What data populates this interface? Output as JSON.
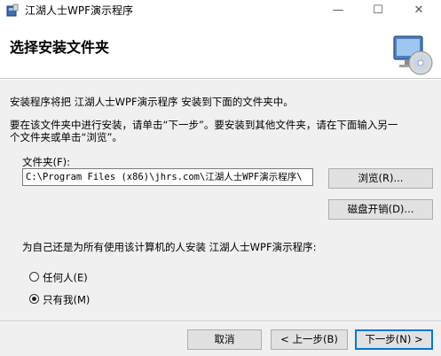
{
  "window": {
    "title": "江湖人士WPF演示程序",
    "minimize_glyph": "—",
    "maximize_glyph": "☐",
    "close_glyph": "✕",
    "app_icon": "installer-icon"
  },
  "header": {
    "title": "选择安装文件夹",
    "icon": "cd-computer-icon"
  },
  "body": {
    "line1": "安装程序将把 江湖人士WPF演示程序 安装到下面的文件夹中。",
    "line2": "要在该文件夹中进行安装，请单击“下一步”。要安装到其他文件夹，请在下面输入另一",
    "line3": "个文件夹或单击“浏览”。",
    "folder_label": "文件夹(F):",
    "folder_value": "C:\\Program Files (x86)\\jhrs.com\\江湖人士WPF演示程序\\",
    "browse_label": "浏览(R)...",
    "disk_cost_label": "磁盘开销(D)...",
    "install_for_label": "为自己还是为所有使用该计算机的人安装 江湖人士WPF演示程序:",
    "options": [
      {
        "label": "任何人(E)",
        "selected": false
      },
      {
        "label": "只有我(M)",
        "selected": true
      }
    ]
  },
  "footer": {
    "cancel_label": "取消",
    "back_label": "< 上一步(B)",
    "next_label": "下一步(N) >"
  },
  "colors": {
    "accent": "#0078d7",
    "background": "#f0f0f0"
  }
}
